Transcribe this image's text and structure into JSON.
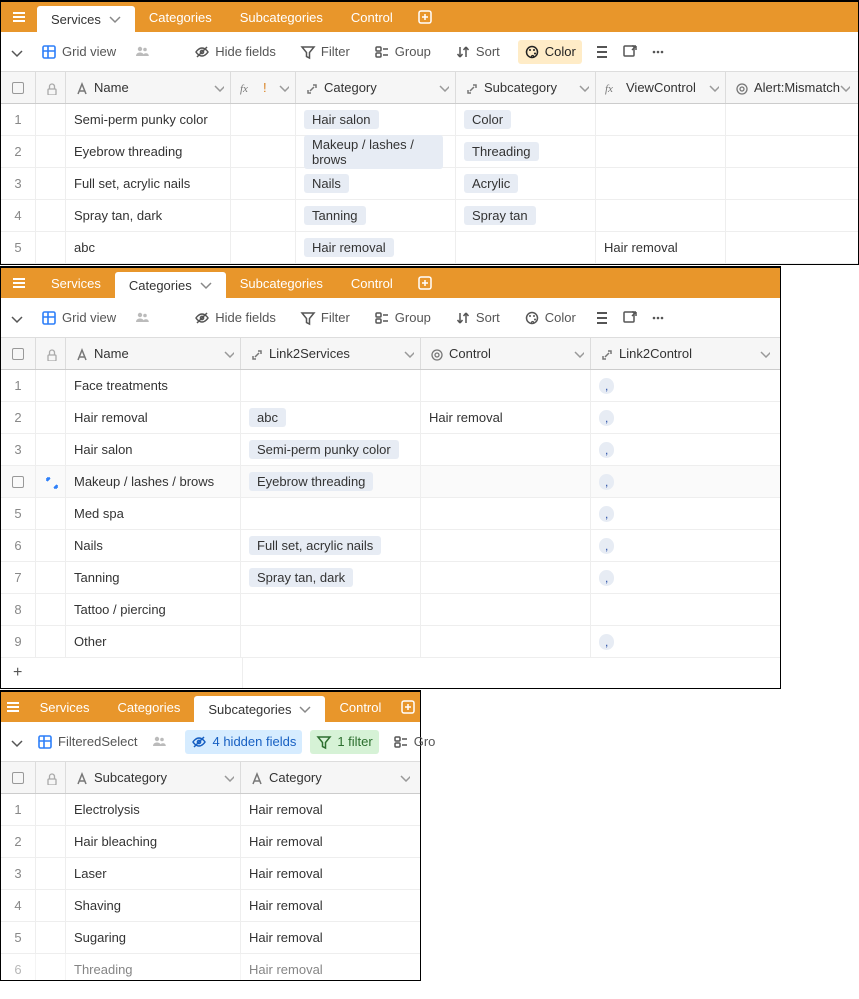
{
  "tabs": {
    "services": "Services",
    "categories": "Categories",
    "subcategories": "Subcategories",
    "control": "Control"
  },
  "toolbar": {
    "grid_view": "Grid view",
    "filtered_select": "FilteredSelect",
    "hide_fields": "Hide fields",
    "hidden_fields_4": "4 hidden fields",
    "filter": "Filter",
    "filter_1": "1 filter",
    "group": "Group",
    "group_short": "Gro",
    "sort": "Sort",
    "color": "Color"
  },
  "panel1": {
    "headers": {
      "name": "Name",
      "category": "Category",
      "subcategory": "Subcategory",
      "viewcontrol": "ViewControl",
      "alert": "Alert:Mismatch"
    },
    "rows": [
      {
        "n": "1",
        "name": "Semi-perm punky color",
        "category": "Hair salon",
        "subcategory": "Color",
        "viewcontrol": "",
        "alert": ""
      },
      {
        "n": "2",
        "name": "Eyebrow threading",
        "category": "Makeup / lashes / brows",
        "subcategory": "Threading",
        "viewcontrol": "",
        "alert": ""
      },
      {
        "n": "3",
        "name": "Full set, acrylic nails",
        "category": "Nails",
        "subcategory": "Acrylic",
        "viewcontrol": "",
        "alert": ""
      },
      {
        "n": "4",
        "name": "Spray tan, dark",
        "category": "Tanning",
        "subcategory": "Spray tan",
        "viewcontrol": "",
        "alert": ""
      },
      {
        "n": "5",
        "name": "abc",
        "category": "Hair removal",
        "subcategory": "",
        "viewcontrol": "Hair removal",
        "alert": ""
      }
    ]
  },
  "panel2": {
    "headers": {
      "name": "Name",
      "link2services": "Link2Services",
      "control": "Control",
      "link2control": "Link2Control"
    },
    "rows": [
      {
        "n": "1",
        "name": "Face treatments",
        "l2s": "",
        "ctrl": "",
        "l2c": ","
      },
      {
        "n": "2",
        "name": "Hair removal",
        "l2s": "abc",
        "ctrl": "Hair removal",
        "l2c": ","
      },
      {
        "n": "3",
        "name": "Hair salon",
        "l2s": "Semi-perm punky color",
        "ctrl": "",
        "l2c": ","
      },
      {
        "n": "4",
        "name": "Makeup / lashes / brows",
        "l2s": "Eyebrow threading",
        "ctrl": "",
        "l2c": ","
      },
      {
        "n": "5",
        "name": "Med spa",
        "l2s": "",
        "ctrl": "",
        "l2c": ","
      },
      {
        "n": "6",
        "name": "Nails",
        "l2s": "Full set, acrylic nails",
        "ctrl": "",
        "l2c": ","
      },
      {
        "n": "7",
        "name": "Tanning",
        "l2s": "Spray tan, dark",
        "ctrl": "",
        "l2c": ","
      },
      {
        "n": "8",
        "name": "Tattoo / piercing",
        "l2s": "",
        "ctrl": "",
        "l2c": ""
      },
      {
        "n": "9",
        "name": "Other",
        "l2s": "",
        "ctrl": "",
        "l2c": ","
      }
    ]
  },
  "panel3": {
    "headers": {
      "subcategory": "Subcategory",
      "category": "Category"
    },
    "rows": [
      {
        "n": "1",
        "name": "Electrolysis",
        "cat": "Hair removal"
      },
      {
        "n": "2",
        "name": "Hair bleaching",
        "cat": "Hair removal"
      },
      {
        "n": "3",
        "name": "Laser",
        "cat": "Hair removal"
      },
      {
        "n": "4",
        "name": "Shaving",
        "cat": "Hair removal"
      },
      {
        "n": "5",
        "name": "Sugaring",
        "cat": "Hair removal"
      },
      {
        "n": "6",
        "name": "Threading",
        "cat": "Hair removal"
      }
    ]
  }
}
